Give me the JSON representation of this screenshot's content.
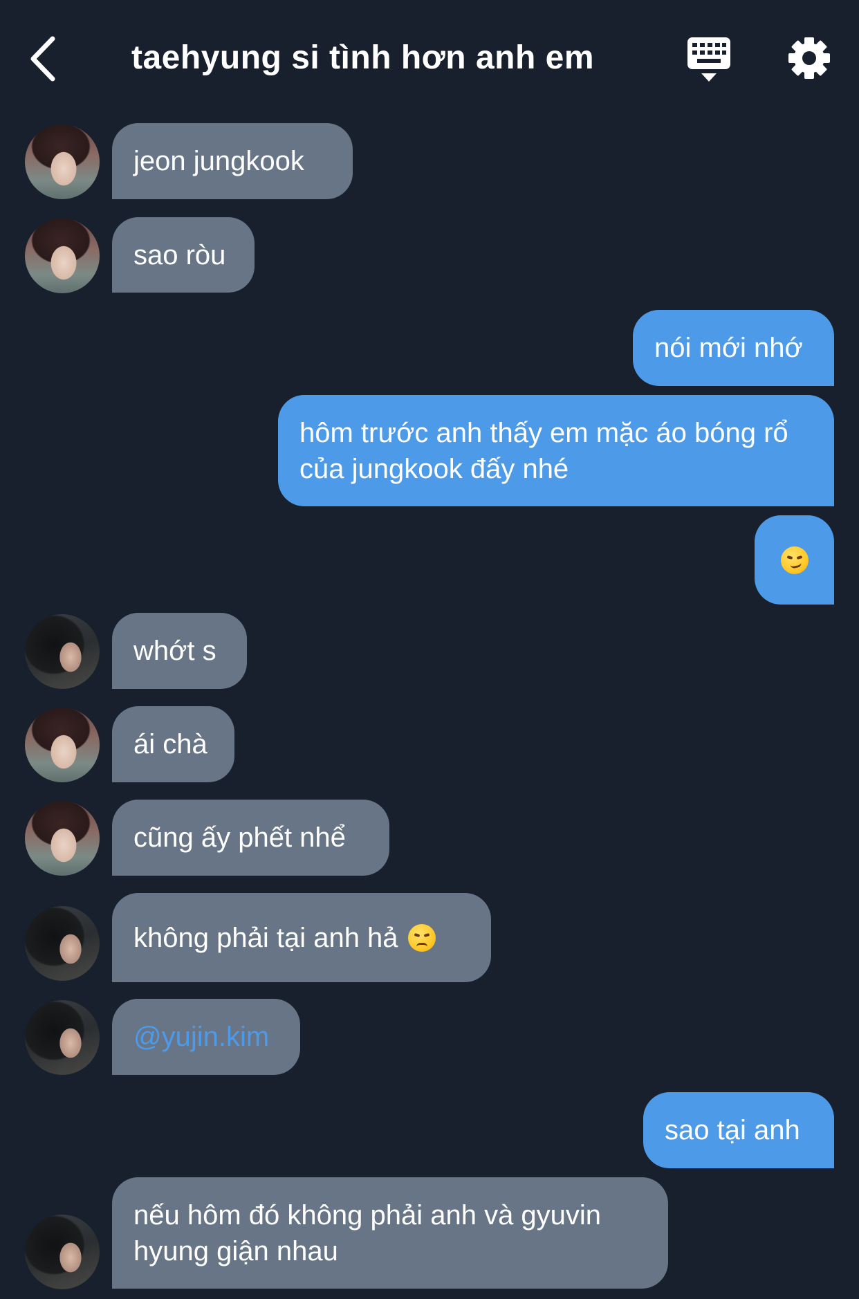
{
  "header": {
    "title": "taehyung si tình hơn anh em",
    "back_icon": "chevron-left-icon",
    "keyboard_icon": "keyboard-icon",
    "settings_icon": "gear-icon"
  },
  "colors": {
    "background": "#17202c",
    "incoming_bubble": "#677587",
    "outgoing_bubble": "#4d9be8",
    "mention_text": "#4d9be8"
  },
  "messages": [
    {
      "side": "in",
      "avatar": "avatar-boy-1",
      "text": "jeon jungkook"
    },
    {
      "side": "in",
      "avatar": "avatar-boy-1",
      "text": "sao ròu"
    },
    {
      "side": "out",
      "text": "nói mới nhớ"
    },
    {
      "side": "out",
      "text": "hôm trước anh thấy em mặc áo bóng rổ của jungkook đấy nhé"
    },
    {
      "side": "out",
      "emoji": "smirking-face-emoji"
    },
    {
      "side": "in",
      "avatar": "avatar-boy-2",
      "text": "whớt s"
    },
    {
      "side": "in",
      "avatar": "avatar-boy-1",
      "text": "ái chà"
    },
    {
      "side": "in",
      "avatar": "avatar-boy-1",
      "text": "cũng ấy phết nhể"
    },
    {
      "side": "in",
      "avatar": "avatar-boy-2",
      "text": "không phải tại anh hả",
      "emoji": "angry-face-emoji"
    },
    {
      "side": "in",
      "avatar": "avatar-boy-2",
      "text": "@yujin.kim",
      "mention": true
    },
    {
      "side": "out",
      "text": "sao tại anh"
    },
    {
      "side": "in",
      "avatar": "avatar-boy-2",
      "text": "nếu hôm đó không phải anh và gyuvin hyung giận nhau"
    }
  ]
}
